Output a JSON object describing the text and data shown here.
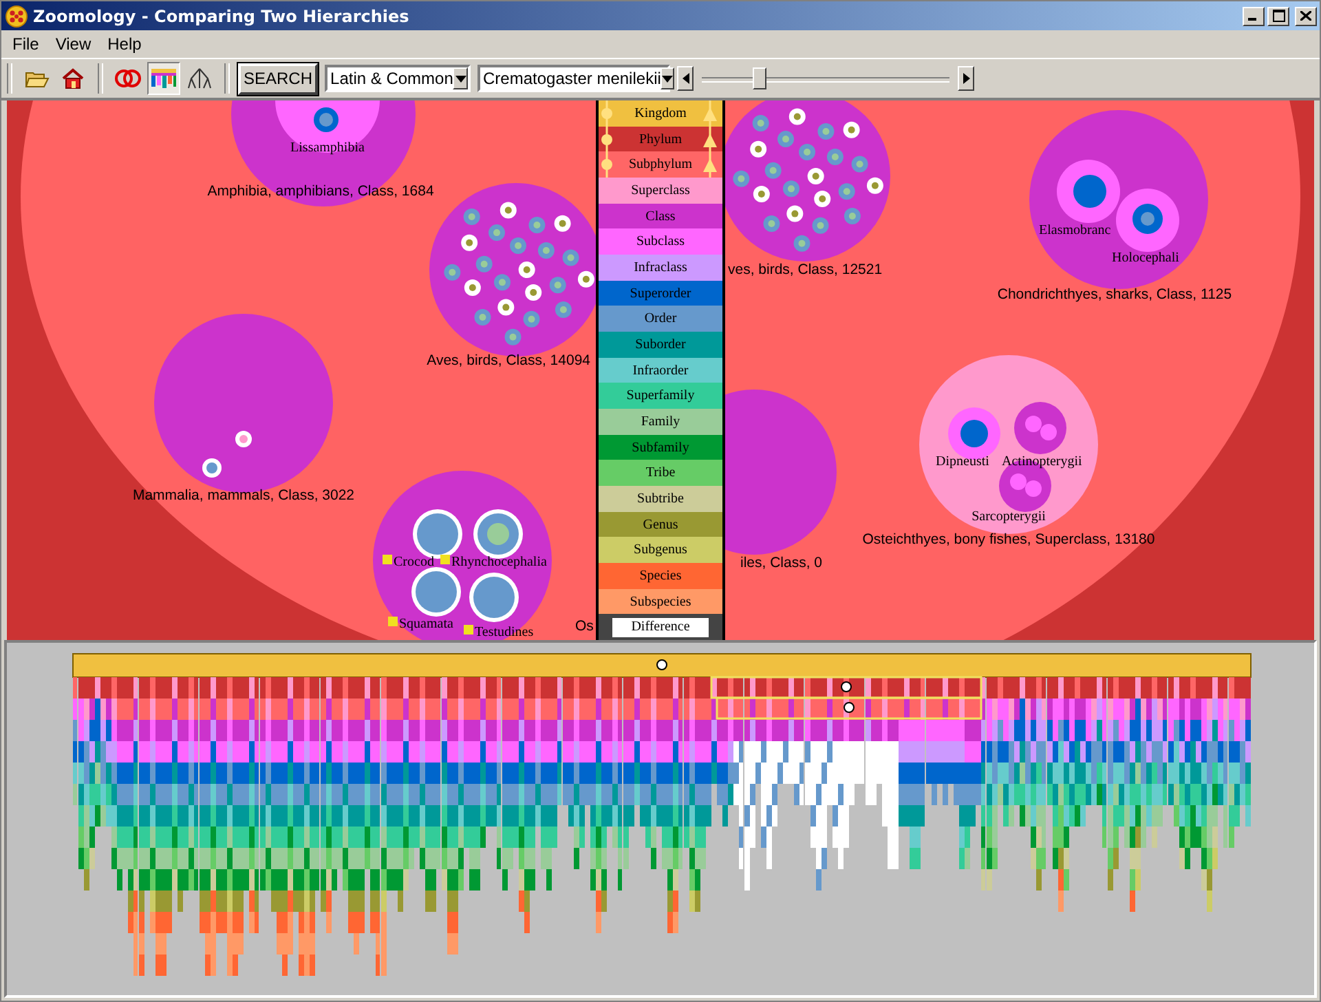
{
  "window": {
    "title": "Zoomology - Comparing Two Hierarchies"
  },
  "menu": [
    "File",
    "View",
    "Help"
  ],
  "toolbar": {
    "view_buttons": [
      {
        "kind": "rings",
        "selected": false
      },
      {
        "kind": "bars",
        "selected": true
      },
      {
        "kind": "tree",
        "selected": false
      }
    ],
    "search_button": "SEARCH",
    "name_mode": "Latin & Common",
    "taxon": "Crematogaster menilekii",
    "slider": {
      "level": 0.22
    }
  },
  "left_pane": {
    "groups": [
      {
        "label": "Amphibia, amphibians, Class, 1684",
        "sublabels": [
          {
            "text": "Lissamphibia",
            "marked": false
          }
        ]
      },
      {
        "label": "Aves, birds, Class, 14094"
      },
      {
        "label": "Mammalia, mammals, Class, 3022"
      },
      {
        "sublabels": [
          {
            "text": "Crocod",
            "marked": true
          },
          {
            "text": "Rhynchocephalia",
            "marked": true
          },
          {
            "text": "Squamata",
            "marked": true
          },
          {
            "text": "Testudines",
            "marked": true
          }
        ]
      },
      {
        "label": "Os"
      }
    ]
  },
  "legend": [
    {
      "rank": "Kingdom",
      "color": "#f0c040",
      "linked": true
    },
    {
      "rank": "Phylum",
      "color": "#cc3333",
      "linked": true
    },
    {
      "rank": "Subphylum",
      "color": "#ff6666",
      "linked": true
    },
    {
      "rank": "Superclass",
      "color": "#ff99cc",
      "linked": false
    },
    {
      "rank": "Class",
      "color": "#cc33cc",
      "linked": false
    },
    {
      "rank": "Subclass",
      "color": "#ff66ff",
      "linked": false
    },
    {
      "rank": "Infraclass",
      "color": "#cc99ff",
      "linked": false
    },
    {
      "rank": "Superorder",
      "color": "#0066cc",
      "linked": false
    },
    {
      "rank": "Order",
      "color": "#6699cc",
      "linked": false
    },
    {
      "rank": "Suborder",
      "color": "#009999",
      "linked": false
    },
    {
      "rank": "Infraorder",
      "color": "#66cccc",
      "linked": false
    },
    {
      "rank": "Superfamily",
      "color": "#33cc99",
      "linked": false
    },
    {
      "rank": "Family",
      "color": "#99cc99",
      "linked": false
    },
    {
      "rank": "Subfamily",
      "color": "#009933",
      "linked": false
    },
    {
      "rank": "Tribe",
      "color": "#66cc66",
      "linked": false
    },
    {
      "rank": "Subtribe",
      "color": "#cccc99",
      "linked": false
    },
    {
      "rank": "Genus",
      "color": "#999933",
      "linked": false
    },
    {
      "rank": "Subgenus",
      "color": "#cccc66",
      "linked": false
    },
    {
      "rank": "Species",
      "color": "#ff6633",
      "linked": false
    },
    {
      "rank": "Subspecies",
      "color": "#ff9966",
      "linked": false
    },
    {
      "rank": "Difference",
      "color": "#ffffff",
      "linked": false,
      "kind": "difference"
    }
  ],
  "right_pane": {
    "groups": [
      {
        "label": "ves, birds, Class, 12521"
      },
      {
        "label": "iles, Class, 0"
      },
      {
        "label": "Chondrichthyes, sharks, Class, 1125",
        "sublabels": [
          {
            "text": "Elasmobranc",
            "marked": false
          },
          {
            "text": "Holocephali",
            "marked": false
          }
        ]
      },
      {
        "label": "Osteichthyes, bony fishes, Superclass, 13180",
        "sublabels": [
          {
            "text": "Dipneusti",
            "marked": false
          },
          {
            "text": "Actinopterygii",
            "marked": false
          },
          {
            "text": "Sarcopterygii",
            "marked": false
          }
        ]
      }
    ]
  }
}
